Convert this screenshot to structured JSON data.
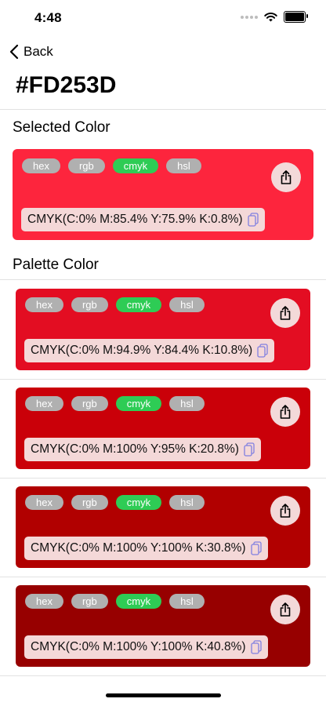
{
  "status_bar": {
    "time": "4:48"
  },
  "nav": {
    "back_label": "Back",
    "title": "#FD253D"
  },
  "selected": {
    "section_title": "Selected Color",
    "card": {
      "bg": "#FD253D",
      "chips": [
        "hex",
        "rgb",
        "cmyk",
        "hsl"
      ],
      "active_chip": "cmyk",
      "value": "CMYK(C:0% M:85.4% Y:75.9% K:0.8%)"
    }
  },
  "palette": {
    "section_title": "Palette Color",
    "cards": [
      {
        "bg": "#E30D22",
        "chips": [
          "hex",
          "rgb",
          "cmyk",
          "hsl"
        ],
        "active_chip": "cmyk",
        "value": "CMYK(C:0% M:94.9% Y:84.4% K:10.8%)"
      },
      {
        "bg": "#CA0009",
        "chips": [
          "hex",
          "rgb",
          "cmyk",
          "hsl"
        ],
        "active_chip": "cmyk",
        "value": "CMYK(C:0% M:100% Y:95% K:20.8%)"
      },
      {
        "bg": "#B10000",
        "chips": [
          "hex",
          "rgb",
          "cmyk",
          "hsl"
        ],
        "active_chip": "cmyk",
        "value": "CMYK(C:0% M:100% Y:100% K:30.8%)"
      },
      {
        "bg": "#970000",
        "chips": [
          "hex",
          "rgb",
          "cmyk",
          "hsl"
        ],
        "active_chip": "cmyk",
        "value": "CMYK(C:0% M:100% Y:100% K:40.8%)"
      }
    ]
  },
  "colors": {
    "chip_inactive": "#B0B0B0",
    "chip_active": "#2ECC55",
    "value_box": "#F4D8D8",
    "share_button": "#F3D9D9",
    "copy_icon": "#7F7FE0"
  },
  "icons": {
    "back": "chevron-left-icon",
    "share": "share-icon",
    "copy": "copy-icon",
    "wifi": "wifi-icon",
    "signal": "cellular-signal-icon",
    "battery": "battery-icon"
  }
}
